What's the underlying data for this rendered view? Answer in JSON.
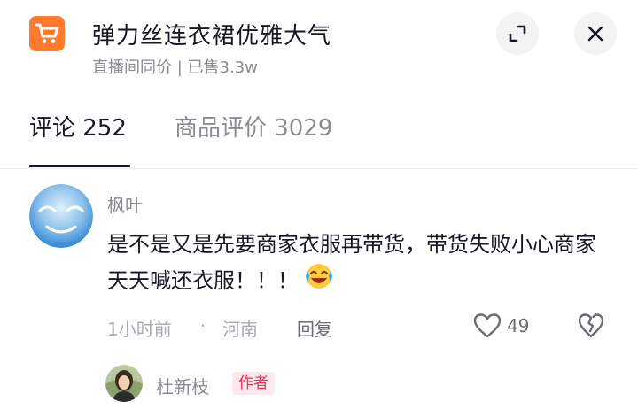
{
  "header": {
    "title": "弹力丝连衣裙优雅大气",
    "subtitle": "直播间同价 | 已售3.3w",
    "icons": {
      "cart": "shopping-cart-icon",
      "expand": "expand-icon",
      "close": "close-icon"
    }
  },
  "tabs": [
    {
      "label": "评论 252",
      "active": true
    },
    {
      "label": "商品评价 3029",
      "active": false
    }
  ],
  "comment": {
    "username": "枫叶",
    "text": "是不是又是先要商家衣服再带货，带货失败小心商家天天喊还衣服！！！",
    "time": "1小时前",
    "separator": "·",
    "location": "河南",
    "reply_label": "回复",
    "likes": "49"
  },
  "reply": {
    "username": "杜新枝",
    "badge": "作者"
  },
  "colors": {
    "accent": "#fe2c55",
    "cart_orange": "#ff7a2d",
    "primary_text": "#161823",
    "secondary_text": "#8a8b91"
  }
}
